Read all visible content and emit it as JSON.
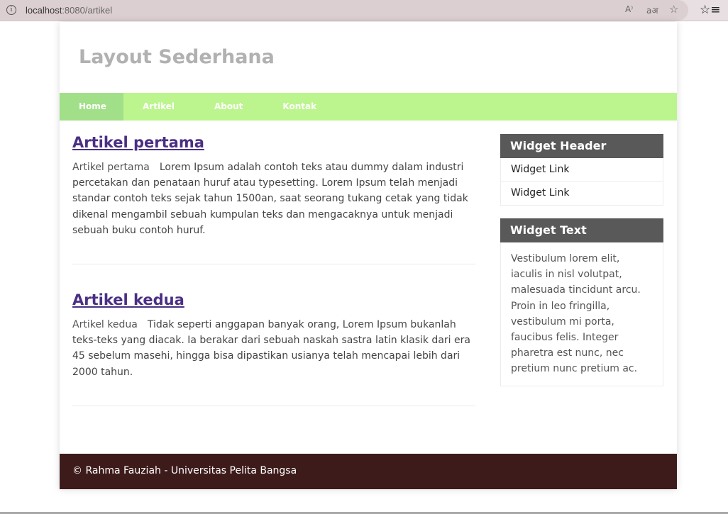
{
  "browser": {
    "url_host": "localhost",
    "url_path": ":8080/artikel",
    "info_icon": "i",
    "read_aloud_icon": "A⁾",
    "translate_icon": "aअ",
    "favorites_add_icon": "☆",
    "favorites_icon": "☆≡"
  },
  "site": {
    "title": "Layout Sederhana"
  },
  "nav": {
    "items": [
      {
        "label": "Home"
      },
      {
        "label": "Artikel"
      },
      {
        "label": "About"
      },
      {
        "label": "Kontak"
      }
    ]
  },
  "articles": [
    {
      "title": "Artikel pertama",
      "image_alt": "Artikel pertama",
      "body": "Lorem Ipsum adalah contoh teks atau dummy dalam industri percetakan dan penataan huruf atau typesetting. Lorem Ipsum telah menjadi standar contoh teks sejak tahun 1500an, saat seorang tukang cetak yang tidak dikenal mengambil sebuah kumpulan teks dan mengacaknya untuk menjadi sebuah buku contoh huruf."
    },
    {
      "title": "Artikel kedua",
      "image_alt": "Artikel kedua",
      "body": "Tidak seperti anggapan banyak orang, Lorem Ipsum bukanlah teks-teks yang diacak. Ia berakar dari sebuah naskah sastra latin klasik dari era 45 sebelum masehi, hingga bisa dipastikan usianya telah mencapai lebih dari 2000 tahun."
    }
  ],
  "sidebar": {
    "widget_header": {
      "title": "Widget Header",
      "links": [
        "Widget Link",
        "Widget Link"
      ]
    },
    "widget_text": {
      "title": "Widget Text",
      "text": "Vestibulum lorem elit, iaculis in nisl volutpat, malesuada tincidunt arcu. Proin in leo fringilla, vestibulum mi porta, faucibus felis. Integer pharetra est nunc, nec pretium nunc pretium ac."
    }
  },
  "footer": {
    "text": "© Rahma Fauziah - Universitas Pelita Bangsa"
  },
  "colors": {
    "nav_bg": "#bcf58e",
    "nav_active": "#a2df89",
    "widget_header_bg": "#595959",
    "footer_bg": "#3e1b1b",
    "title_gray": "#b1b1b1",
    "link_purple": "#4a2f84"
  }
}
